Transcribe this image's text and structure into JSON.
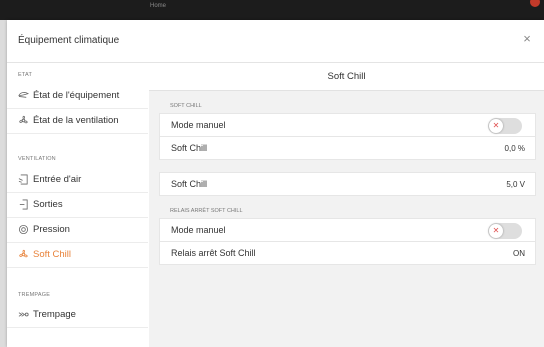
{
  "window": {
    "title": "Home"
  },
  "dialog": {
    "title": "Équipement climatique",
    "close_label": "×"
  },
  "sidebar": {
    "sections": [
      {
        "label": "ETAT",
        "items": [
          {
            "label": "État de l'équipement",
            "icon": "fan-blade-icon"
          },
          {
            "label": "État de la ventilation",
            "icon": "fan-icon"
          }
        ]
      },
      {
        "label": "VENTILATION",
        "items": [
          {
            "label": "Entrée d'air",
            "icon": "air-inlet-icon"
          },
          {
            "label": "Sorties",
            "icon": "outlet-icon"
          },
          {
            "label": "Pression",
            "icon": "pressure-gauge-icon"
          },
          {
            "label": "Soft Chill",
            "icon": "soft-chill-icon",
            "active": true
          }
        ]
      },
      {
        "label": "TREMPAGE",
        "items": [
          {
            "label": "Trempage",
            "icon": "soaking-icon"
          }
        ]
      }
    ],
    "active_color": "#e8823a"
  },
  "main": {
    "title": "Soft Chill",
    "groups": [
      {
        "label": "SOFT CHILL",
        "rows": [
          {
            "label": "Mode manuel",
            "type": "toggle",
            "on": false
          },
          {
            "label": "Soft Chill",
            "value": "0,0 %"
          }
        ]
      },
      {
        "label": "",
        "rows": [
          {
            "label": "Soft Chill",
            "value": "5,0 V"
          }
        ]
      },
      {
        "label": "RELAIS ARRÊT SOFT CHILL",
        "rows": [
          {
            "label": "Mode manuel",
            "type": "toggle",
            "on": false
          },
          {
            "label": "Relais arrêt Soft Chill",
            "value": "ON"
          }
        ]
      }
    ]
  }
}
